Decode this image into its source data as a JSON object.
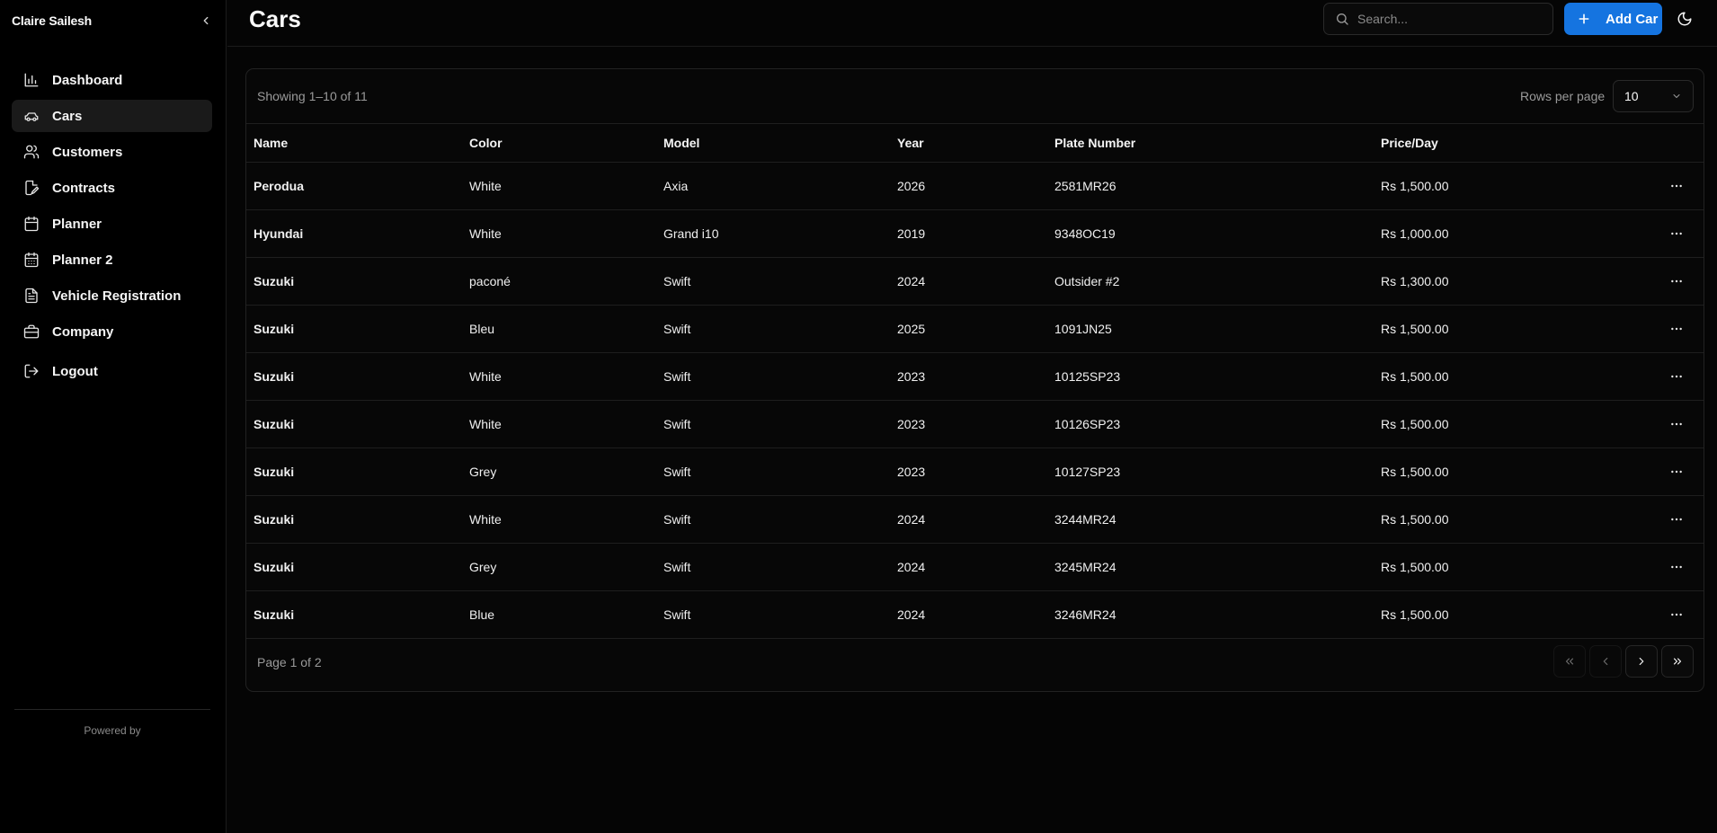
{
  "sidebar": {
    "user_name": "Claire Sailesh",
    "items": [
      {
        "label": "Dashboard",
        "icon": "bar-chart-icon"
      },
      {
        "label": "Cars",
        "icon": "car-icon"
      },
      {
        "label": "Customers",
        "icon": "users-icon"
      },
      {
        "label": "Contracts",
        "icon": "file-edit-icon"
      },
      {
        "label": "Planner",
        "icon": "calendar-icon"
      },
      {
        "label": "Planner 2",
        "icon": "calendar-days-icon"
      },
      {
        "label": "Vehicle Registration",
        "icon": "file-text-icon"
      },
      {
        "label": "Company",
        "icon": "briefcase-icon"
      }
    ],
    "active_item": "Cars",
    "logout_label": "Logout",
    "powered_by": "Powered by"
  },
  "header": {
    "title": "Cars",
    "search_placeholder": "Search...",
    "add_button_label": "Add Car"
  },
  "table": {
    "showing_text": "Showing 1–10 of 11",
    "rows_per_page_label": "Rows per page",
    "rows_per_page_value": "10",
    "columns": [
      "Name",
      "Color",
      "Model",
      "Year",
      "Plate Number",
      "Price/Day"
    ],
    "rows": [
      {
        "name": "Perodua",
        "color": "White",
        "model": "Axia",
        "year": "2026",
        "plate": "2581MR26",
        "price": "Rs 1,500.00"
      },
      {
        "name": "Hyundai",
        "color": "White",
        "model": "Grand i10",
        "year": "2019",
        "plate": "9348OC19",
        "price": "Rs 1,000.00"
      },
      {
        "name": "Suzuki",
        "color": "paconé",
        "model": "Swift",
        "year": "2024",
        "plate": "Outsider #2",
        "price": "Rs 1,300.00"
      },
      {
        "name": "Suzuki",
        "color": "Bleu",
        "model": "Swift",
        "year": "2025",
        "plate": "1091JN25",
        "price": "Rs 1,500.00"
      },
      {
        "name": "Suzuki",
        "color": "White",
        "model": "Swift",
        "year": "2023",
        "plate": "10125SP23",
        "price": "Rs 1,500.00"
      },
      {
        "name": "Suzuki",
        "color": "White",
        "model": "Swift",
        "year": "2023",
        "plate": "10126SP23",
        "price": "Rs 1,500.00"
      },
      {
        "name": "Suzuki",
        "color": "Grey",
        "model": "Swift",
        "year": "2023",
        "plate": "10127SP23",
        "price": "Rs 1,500.00"
      },
      {
        "name": "Suzuki",
        "color": "White",
        "model": "Swift",
        "year": "2024",
        "plate": "3244MR24",
        "price": "Rs 1,500.00"
      },
      {
        "name": "Suzuki",
        "color": "Grey",
        "model": "Swift",
        "year": "2024",
        "plate": "3245MR24",
        "price": "Rs 1,500.00"
      },
      {
        "name": "Suzuki",
        "color": "Blue",
        "model": "Swift",
        "year": "2024",
        "plate": "3246MR24",
        "price": "Rs 1,500.00"
      }
    ],
    "page_info": "Page 1 of 2"
  },
  "colors": {
    "background": "#050505",
    "accent": "#1574e0",
    "border": "#222222"
  }
}
